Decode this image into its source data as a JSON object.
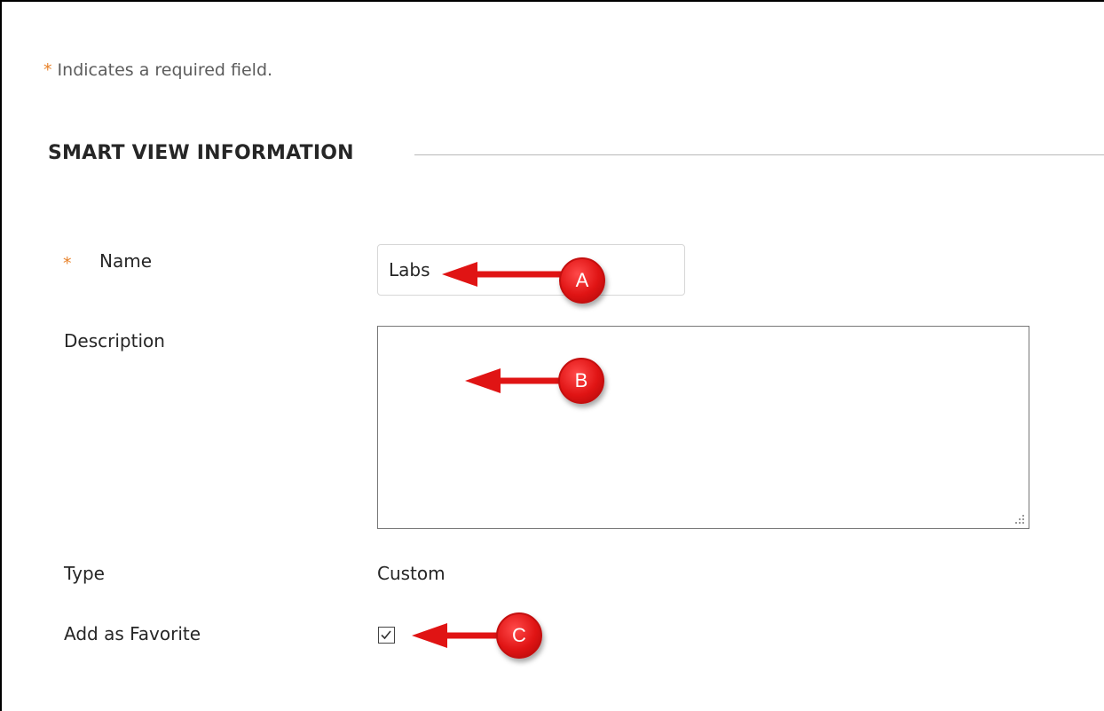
{
  "required_note": {
    "star": "*",
    "text": "Indicates a required field."
  },
  "section": {
    "title": "SMART VIEW INFORMATION"
  },
  "form": {
    "name": {
      "star": "*",
      "label": "Name",
      "value": "Labs"
    },
    "description": {
      "label": "Description",
      "value": ""
    },
    "type": {
      "label": "Type",
      "value": "Custom"
    },
    "favorite": {
      "label": "Add as Favorite",
      "checked": true,
      "check_glyph": "✓"
    }
  },
  "callouts": {
    "a": "A",
    "b": "B",
    "c": "C"
  },
  "colors": {
    "required_star": "#e8822a",
    "callout_red": "#e01414",
    "text": "#262626"
  }
}
